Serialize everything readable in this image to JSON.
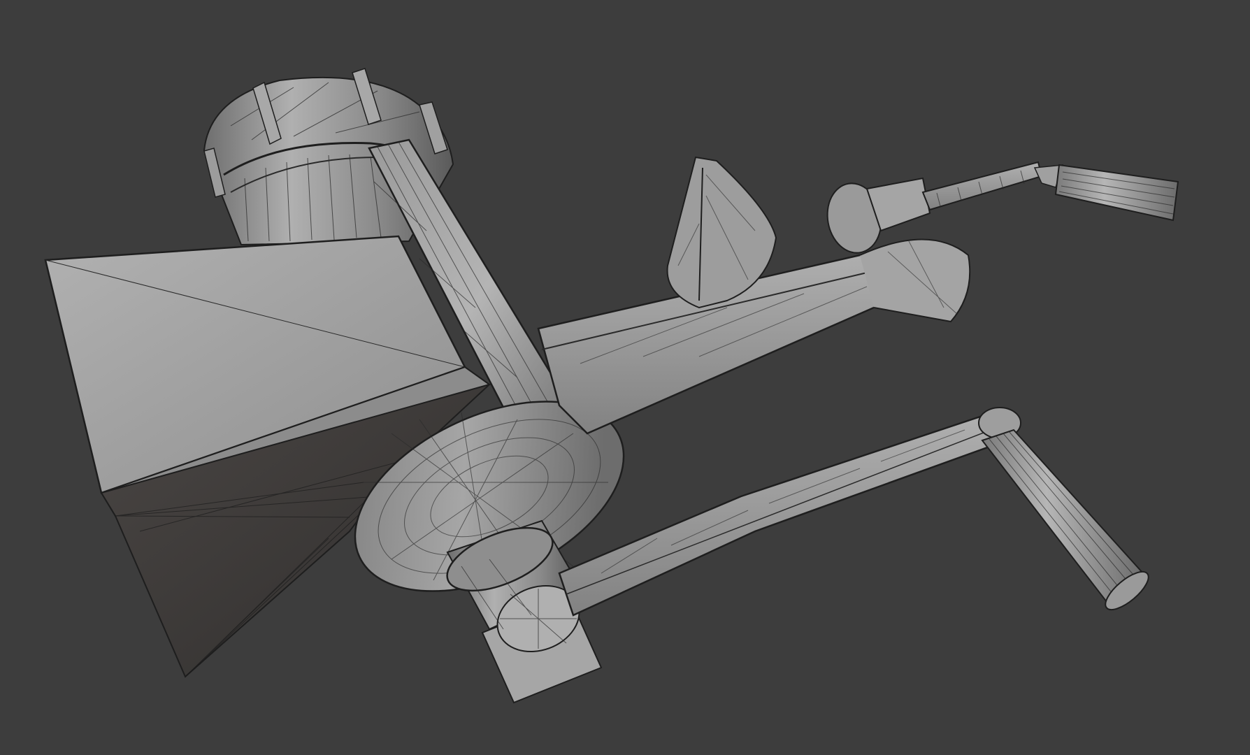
{
  "viewport": {
    "mode": "3d-viewport",
    "shading": "solid-wireframe-overlay",
    "background_color": "#3d3d3d",
    "model": "meat grinder",
    "model_colors": {
      "light": "#a2a2a2",
      "mid": "#8c8c8c",
      "dark": "#5a5a5a",
      "shadow": "#3a3735",
      "wire": "#1e1e1e"
    }
  }
}
